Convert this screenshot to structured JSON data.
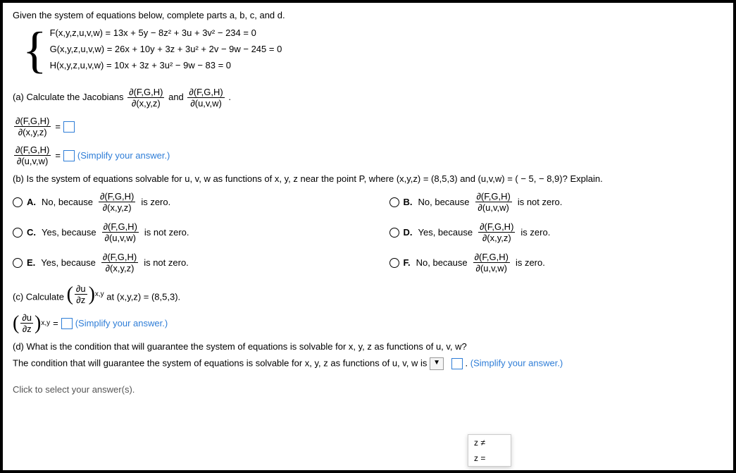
{
  "instruction": "Given the system of equations below, complete parts a, b, c, and d.",
  "equations": {
    "F": "F(x,y,z,u,v,w) = 13x + 5y − 8z² + 3u + 3v² − 234 = 0",
    "G": "G(x,y,z,u,v,w) = 26x + 10y + 3z + 3u² + 2v − 9w − 245 = 0",
    "H": "H(x,y,z,u,v,w) = 10x + 3z + 3u² − 9w − 83 = 0"
  },
  "partA": {
    "prompt_prefix": "(a) Calculate the Jacobians ",
    "and": " and ",
    "dot": ".",
    "J1_num": "∂(F,G,H)",
    "J1_den": "∂(x,y,z)",
    "J2_num": "∂(F,G,H)",
    "J2_den": "∂(u,v,w)",
    "eq": "= ",
    "simplify": "(Simplify your answer.)"
  },
  "partB": {
    "prompt": "(b) Is the system of equations solvable for u, v, w as functions of x, y, z near the point P, where (x,y,z) = (8,5,3) and (u,v,w) = ( − 5, − 8,9)? Explain.",
    "A": {
      "letter": "A.",
      "verdict": "No, because ",
      "num": "∂(F,G,H)",
      "den": "∂(x,y,z)",
      "tail": " is zero."
    },
    "B": {
      "letter": "B.",
      "verdict": "No, because ",
      "num": "∂(F,G,H)",
      "den": "∂(u,v,w)",
      "tail": " is not zero."
    },
    "C": {
      "letter": "C.",
      "verdict": "Yes, because ",
      "num": "∂(F,G,H)",
      "den": "∂(u,v,w)",
      "tail": " is not zero."
    },
    "D": {
      "letter": "D.",
      "verdict": "Yes, because ",
      "num": "∂(F,G,H)",
      "den": "∂(x,y,z)",
      "tail": " is zero."
    },
    "E": {
      "letter": "E.",
      "verdict": "Yes, because ",
      "num": "∂(F,G,H)",
      "den": "∂(x,y,z)",
      "tail": " is not zero."
    },
    "F": {
      "letter": "F.",
      "verdict": "No, because ",
      "num": "∂(F,G,H)",
      "den": "∂(u,v,w)",
      "tail": " is zero."
    }
  },
  "partC": {
    "prefix": "(c) Calculate ",
    "du": "∂u",
    "dz": "∂z",
    "sub": "x,y",
    "at": " at (x,y,z) = (8,5,3).",
    "eq": " = ",
    "simplify": "(Simplify your answer.)"
  },
  "partD": {
    "q": "(d) What is the condition that will guarantee the system of equations is solvable for x, y, z as functions of u, v, w?",
    "line_prefix": "The condition that will guarantee the system of equations is solvable for x, y, z as functions of u, v, w is ",
    "dropdown_arrow": "▼",
    "line_suffix": ". ",
    "simplify": "(Simplify your answer.)",
    "opt1": "z ≠",
    "opt2": "z ="
  },
  "footer": "Click to select your answer(s)."
}
